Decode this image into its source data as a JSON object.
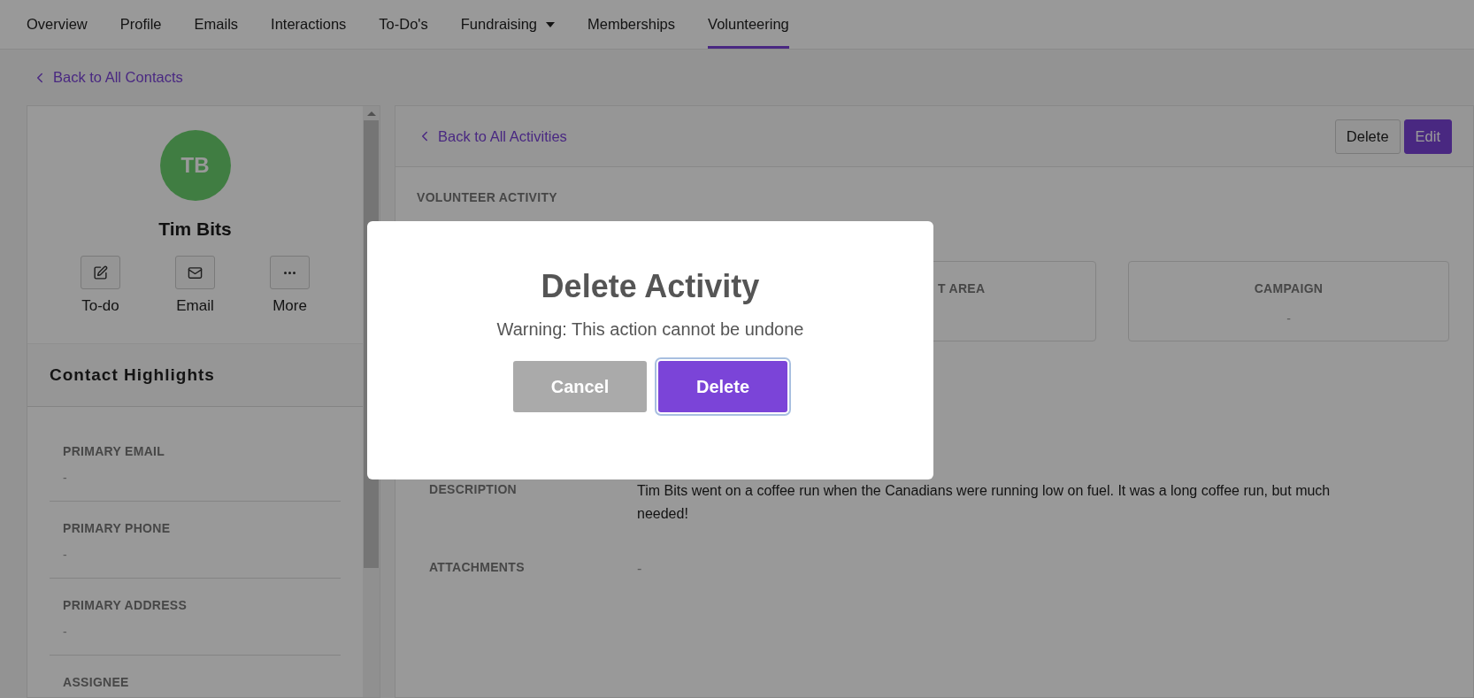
{
  "tabs": [
    {
      "label": "Overview",
      "selected": false,
      "has_menu": false
    },
    {
      "label": "Profile",
      "selected": false,
      "has_menu": false
    },
    {
      "label": "Emails",
      "selected": false,
      "has_menu": false
    },
    {
      "label": "Interactions",
      "selected": false,
      "has_menu": false
    },
    {
      "label": "To-Do's",
      "selected": false,
      "has_menu": false
    },
    {
      "label": "Fundraising",
      "selected": false,
      "has_menu": true
    },
    {
      "label": "Memberships",
      "selected": false,
      "has_menu": false
    },
    {
      "label": "Volunteering",
      "selected": true,
      "has_menu": false
    }
  ],
  "back_link": "Back to All Contacts",
  "contact": {
    "initials": "TB",
    "name": "Tim Bits",
    "actions": [
      {
        "label": "To-do",
        "kind": "todo"
      },
      {
        "label": "Email",
        "kind": "email"
      },
      {
        "label": "More",
        "kind": "more"
      }
    ],
    "highlights_title": "Contact Highlights",
    "fields": [
      {
        "label": "PRIMARY EMAIL",
        "value": "-"
      },
      {
        "label": "PRIMARY PHONE",
        "value": "-"
      },
      {
        "label": "PRIMARY ADDRESS",
        "value": "-"
      },
      {
        "label": "ASSIGNEE"
      }
    ]
  },
  "activity": {
    "back_link": "Back to All Activities",
    "buttons": [
      {
        "label": "Delete",
        "kind": "secondary"
      },
      {
        "label": "Edit",
        "kind": "primary"
      }
    ],
    "type_label": "VOLUNTEER ACTIVITY",
    "cards": [
      {
        "label": "T AREA",
        "kind": "cut"
      },
      {
        "label": "CAMPAIGN",
        "value": "-",
        "kind": "full"
      }
    ],
    "details": [
      {
        "label": "DESCRIPTION",
        "value": "Tim Bits went on a coffee run when the Canadians were running low on fuel. It was a long coffee run, but much needed!"
      },
      {
        "label": "ATTACHMENTS",
        "value": "-"
      }
    ]
  },
  "modal": {
    "title": "Delete Activity",
    "message": "Warning: This action cannot be undone",
    "buttons": [
      {
        "label": "Cancel",
        "kind": "cancel",
        "focused": false
      },
      {
        "label": "Delete",
        "kind": "confirm",
        "focused": true
      }
    ]
  }
}
